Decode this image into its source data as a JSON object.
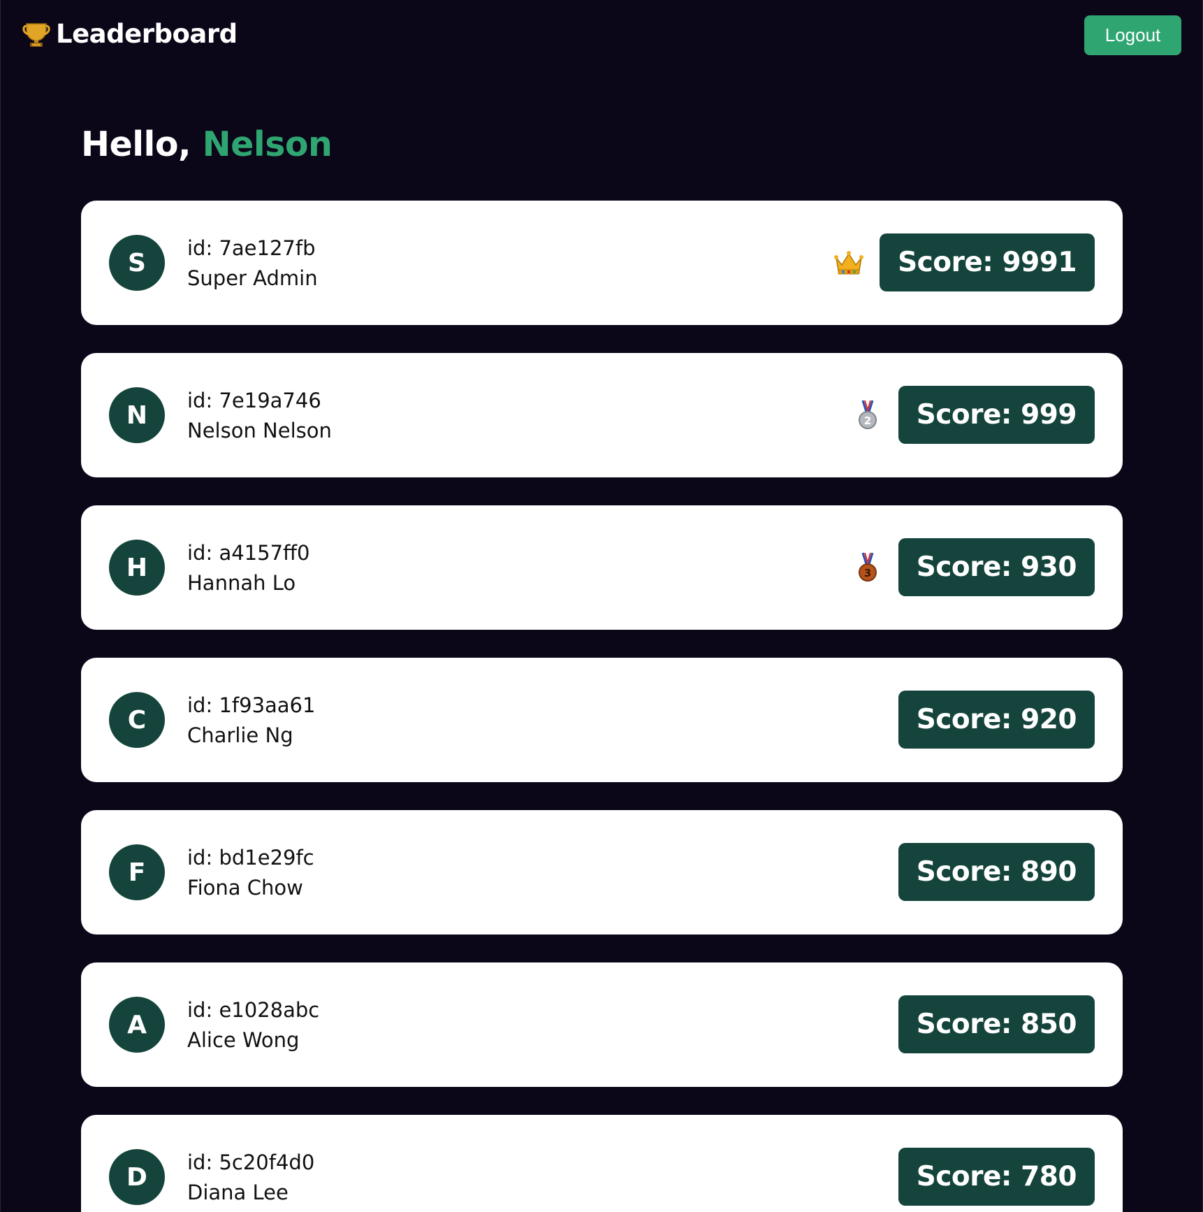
{
  "header": {
    "title": "Leaderboard",
    "brand_icon": "trophy-icon",
    "logout_label": "Logout"
  },
  "greeting": {
    "prefix": "Hello, ",
    "name": "Nelson"
  },
  "colors": {
    "background": "#0c0619",
    "accent": "#2fa671",
    "score_bg": "#14443c",
    "card_bg": "#ffffff"
  },
  "players": [
    {
      "initial": "S",
      "id": "id: 7ae127fb",
      "name": "Super Admin",
      "badge": "crown-icon",
      "score": "Score: 9991"
    },
    {
      "initial": "N",
      "id": "id: 7e19a746",
      "name": "Nelson Nelson",
      "badge": "silver-medal-icon",
      "score": "Score: 999"
    },
    {
      "initial": "H",
      "id": "id: a4157ff0",
      "name": "Hannah Lo",
      "badge": "bronze-medal-icon",
      "score": "Score: 930"
    },
    {
      "initial": "C",
      "id": "id: 1f93aa61",
      "name": "Charlie Ng",
      "badge": "",
      "score": "Score: 920"
    },
    {
      "initial": "F",
      "id": "id: bd1e29fc",
      "name": "Fiona Chow",
      "badge": "",
      "score": "Score: 890"
    },
    {
      "initial": "A",
      "id": "id: e1028abc",
      "name": "Alice Wong",
      "badge": "",
      "score": "Score: 850"
    },
    {
      "initial": "D",
      "id": "id: 5c20f4d0",
      "name": "Diana Lee",
      "badge": "",
      "score": "Score: 780"
    }
  ]
}
